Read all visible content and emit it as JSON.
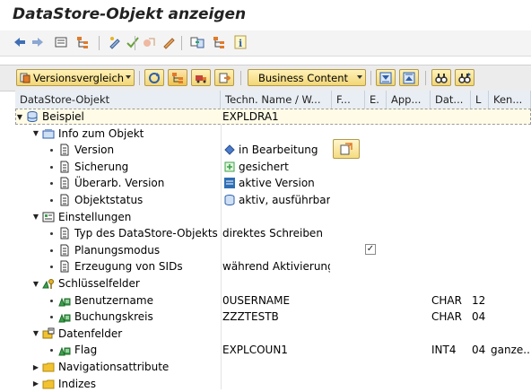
{
  "title": "DataStore-Objekt anzeigen",
  "std_toolbar": {
    "icons": [
      "back-arrow-icon",
      "forward-arrow-icon",
      "other-object-icon",
      "hierarchy-icon",
      "display-change-icon",
      "check-icon",
      "activate-icon",
      "where-used-icon",
      "info-icon"
    ]
  },
  "app_toolbar": {
    "version_compare_label": "Versionsvergleich",
    "business_content_label": "Business Content"
  },
  "columns": [
    "DataStore-Objekt",
    "Techn. Name / W...",
    "F...",
    "E.",
    "App...",
    "Dat...",
    "L",
    "Ken..."
  ],
  "rows": [
    {
      "level": 0,
      "toggle": "open",
      "icon": "datastore-icon",
      "label": "Beispiel",
      "tech": "EXPLDRA1",
      "selected": true
    },
    {
      "level": 1,
      "toggle": "open",
      "icon": "info-folder-icon",
      "label": "Info zum Objekt"
    },
    {
      "level": 2,
      "toggle": "dot",
      "icon": "document-icon",
      "label": "Version",
      "status_icon": "diamond-icon",
      "tech": "in Bearbeitung",
      "has_button": true
    },
    {
      "level": 2,
      "toggle": "dot",
      "icon": "document-icon",
      "label": "Sicherung",
      "status_icon": "plus-box-icon",
      "tech": "gesichert"
    },
    {
      "level": 2,
      "toggle": "dot",
      "icon": "document-icon",
      "label": "Überarb. Version",
      "status_icon": "active-version-icon",
      "tech": "aktive Version"
    },
    {
      "level": 2,
      "toggle": "dot",
      "icon": "document-icon",
      "label": "Objektstatus",
      "status_icon": "database-icon",
      "tech": "aktiv, ausführbar"
    },
    {
      "level": 1,
      "toggle": "open",
      "icon": "settings-icon",
      "label": "Einstellungen"
    },
    {
      "level": 2,
      "toggle": "dot",
      "icon": "document-icon",
      "label": "Typ des DataStore-Objekts",
      "tech": "direktes Schreiben"
    },
    {
      "level": 2,
      "toggle": "dot",
      "icon": "document-icon",
      "label": "Planungsmodus",
      "checkbox": "✓"
    },
    {
      "level": 2,
      "toggle": "dot",
      "icon": "document-icon",
      "label": "Erzeugung von SIDs",
      "tech": "während Aktivierung"
    },
    {
      "level": 1,
      "toggle": "open",
      "icon": "key-fields-icon",
      "label": "Schlüsselfelder"
    },
    {
      "level": 2,
      "toggle": "dot",
      "icon": "characteristic-icon",
      "label": "Benutzername",
      "tech": "0USERNAME",
      "dat": "CHAR",
      "l": "12"
    },
    {
      "level": 2,
      "toggle": "dot",
      "icon": "characteristic-icon",
      "label": "Buchungskreis",
      "tech": "ZZZTESTB",
      "dat": "CHAR",
      "l": "04"
    },
    {
      "level": 1,
      "toggle": "open",
      "icon": "data-fields-icon",
      "label": "Datenfelder"
    },
    {
      "level": 2,
      "toggle": "dot",
      "icon": "characteristic-icon",
      "label": "Flag",
      "tech": "EXPLCOUN1",
      "dat": "INT4",
      "l": "04",
      "ken": "ganze..."
    },
    {
      "level": 1,
      "toggle": "closed",
      "icon": "folder-icon",
      "label": "Navigationsattribute"
    },
    {
      "level": 1,
      "toggle": "closed",
      "icon": "folder-icon",
      "label": "Indizes"
    }
  ],
  "colors": {
    "folder": "#f2c230",
    "header_bg": "#e9eef4",
    "toolbar_btn": "#f2d677",
    "accent_blue": "#2f5fa8"
  }
}
